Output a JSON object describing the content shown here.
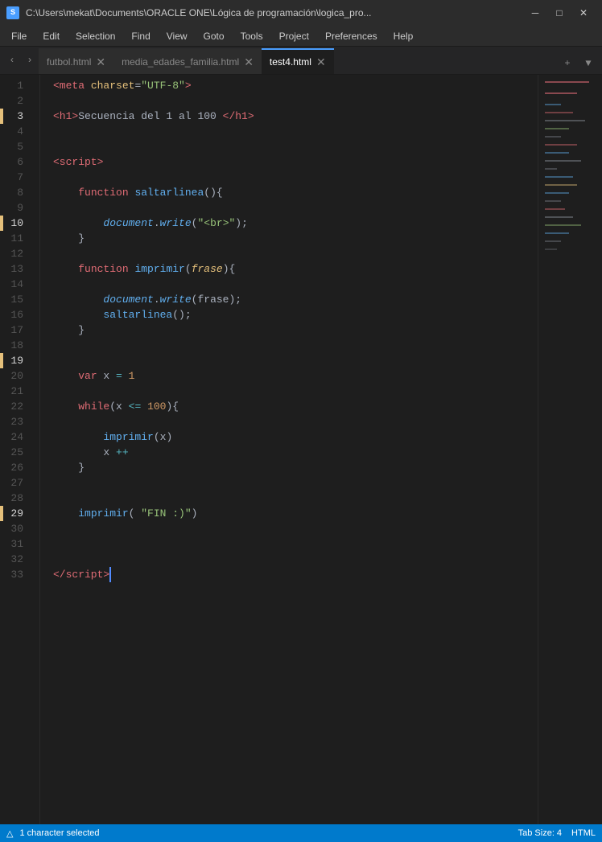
{
  "titlebar": {
    "icon": "S",
    "path": "C:\\Users\\mekat\\Documents\\ORACLE ONE\\Lógica de programación\\logica_pro...",
    "minimize": "─",
    "maximize": "□",
    "close": "✕"
  },
  "menu": {
    "items": [
      "File",
      "Edit",
      "Selection",
      "Find",
      "View",
      "Goto",
      "Tools",
      "Project",
      "Preferences",
      "Help"
    ]
  },
  "tabs": {
    "prev": "<",
    "next": ">",
    "items": [
      {
        "label": "futbol.html",
        "active": false
      },
      {
        "label": "media_edades_familia.html",
        "active": false
      },
      {
        "label": "test4.html",
        "active": true
      }
    ],
    "add": "+",
    "menu": "▾"
  },
  "statusbar": {
    "git_icon": "⑂",
    "selection": "1 character selected",
    "tab_size": "Tab Size: 4",
    "language": "HTML"
  },
  "lines": [
    1,
    2,
    3,
    4,
    5,
    6,
    7,
    8,
    9,
    10,
    11,
    12,
    13,
    14,
    15,
    16,
    17,
    18,
    19,
    20,
    21,
    22,
    23,
    24,
    25,
    26,
    27,
    28,
    29,
    30,
    31,
    32,
    33
  ],
  "highlighted_lines": [
    3,
    10,
    19,
    29
  ]
}
